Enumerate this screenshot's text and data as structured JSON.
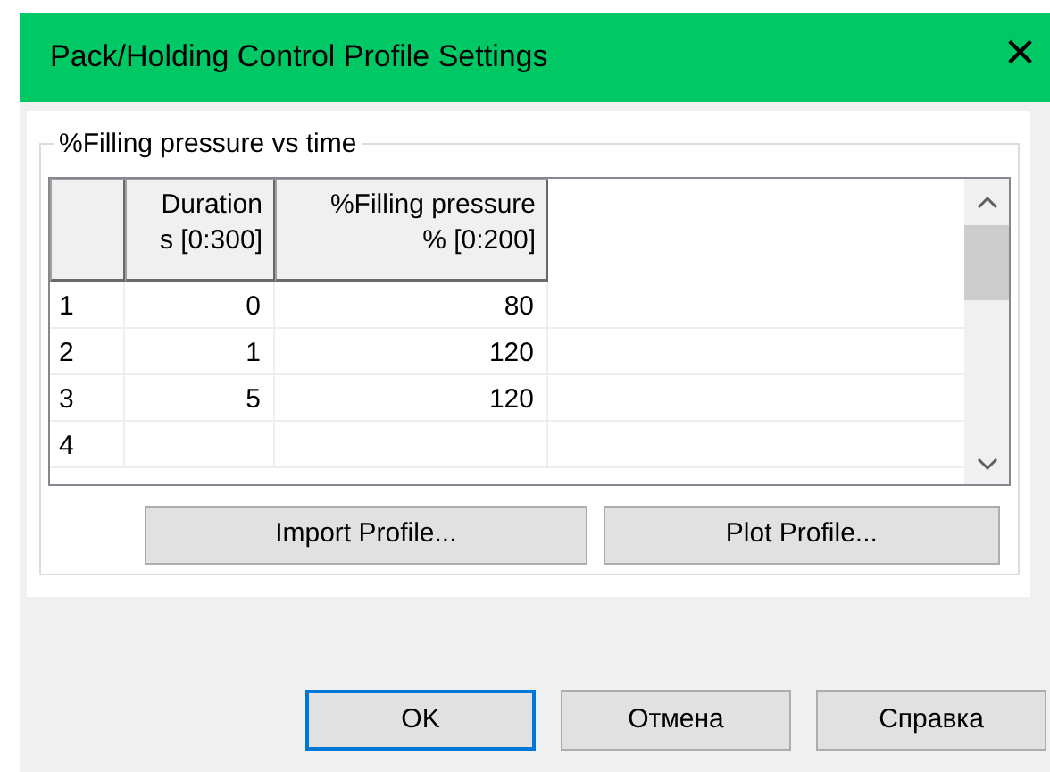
{
  "window": {
    "title": "Pack/Holding Control Profile Settings",
    "close": "×"
  },
  "group": {
    "title": "%Filling pressure vs time"
  },
  "table": {
    "columns": [
      {
        "line1": "Duration",
        "line2": "s [0:300]"
      },
      {
        "line1": "%Filling pressure",
        "line2": "% [0:200]"
      }
    ],
    "rows": [
      {
        "index": "1",
        "cells": [
          "0",
          "80"
        ]
      },
      {
        "index": "2",
        "cells": [
          "1",
          "120"
        ]
      },
      {
        "index": "3",
        "cells": [
          "5",
          "120"
        ]
      },
      {
        "index": "4",
        "cells": [
          "",
          ""
        ]
      }
    ]
  },
  "actions": [
    "Import Profile...",
    "Plot Profile..."
  ],
  "buttons": [
    {
      "label": "OK",
      "default": true
    },
    {
      "label": "Отмена",
      "default": false
    },
    {
      "label": "Справка",
      "default": false
    }
  ]
}
